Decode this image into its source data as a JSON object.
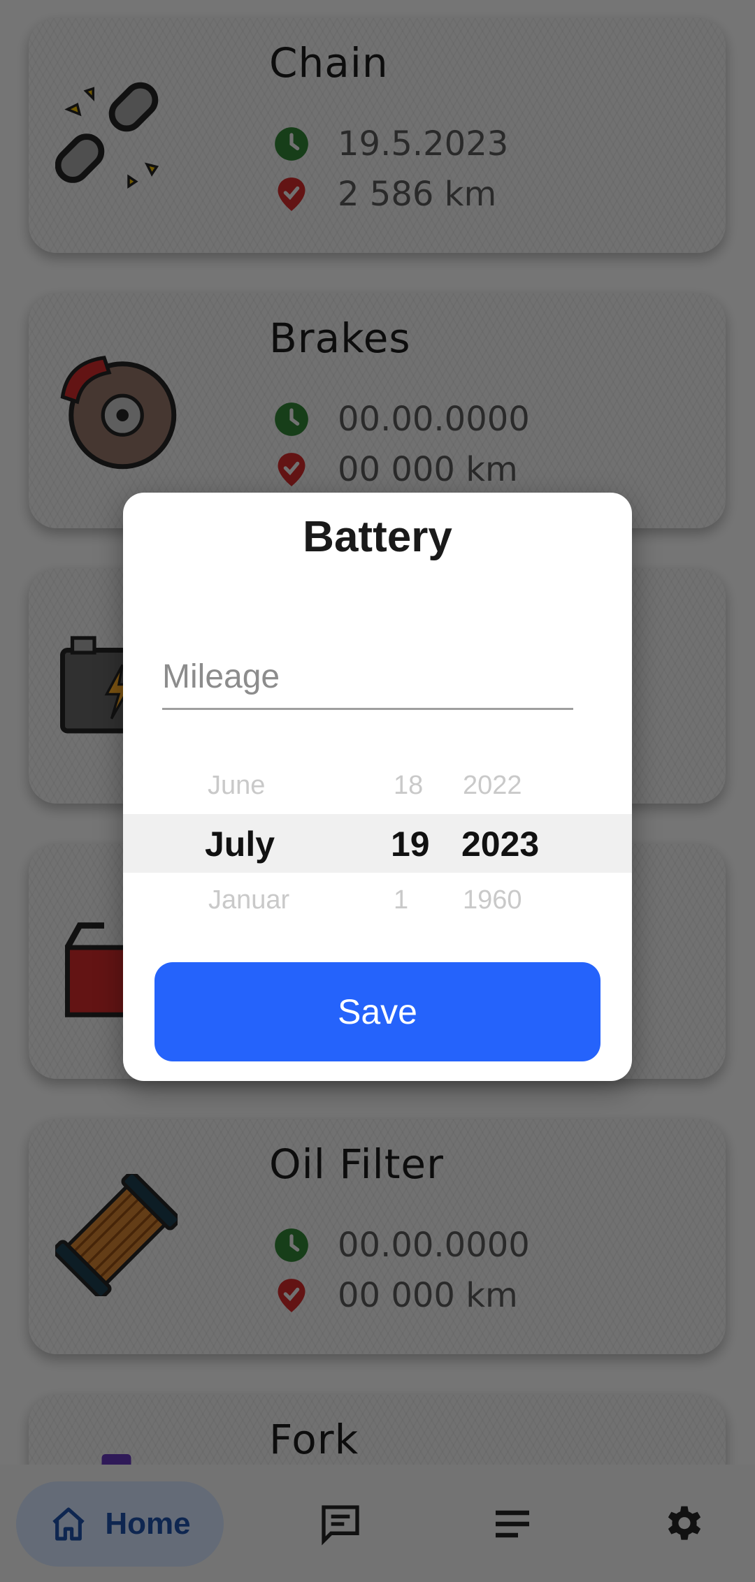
{
  "cards": [
    {
      "title": "Chain",
      "date": "19.5.2023",
      "mileage": "2 586 km",
      "icon": "chain-icon"
    },
    {
      "title": "Brakes",
      "date": "00.00.0000",
      "mileage": "00 000 km",
      "icon": "brake-disc-icon"
    },
    {
      "title": "",
      "date": "",
      "mileage": "",
      "icon": "battery-icon"
    },
    {
      "title": "",
      "date": "",
      "mileage": "",
      "icon": "oil-can-icon"
    },
    {
      "title": "Oil Filter",
      "date": "00.00.0000",
      "mileage": "00 000 km",
      "icon": "oil-filter-icon"
    },
    {
      "title": "Fork",
      "date": "",
      "mileage": "",
      "icon": "fork-icon"
    }
  ],
  "dialog": {
    "title": "Battery",
    "mileage_placeholder": "Mileage",
    "picker": {
      "month": {
        "prev": "June",
        "selected": "July",
        "next": "Januar"
      },
      "day": {
        "prev": "18",
        "selected": "19",
        "next": "1"
      },
      "year": {
        "prev": "2022",
        "selected": "2023",
        "next": "1960"
      }
    },
    "save_label": "Save"
  },
  "nav": {
    "home_label": "Home",
    "accent": "#1c4da1"
  },
  "colors": {
    "save_button": "#2563fb",
    "clock_green": "#2e7d32",
    "pin_red": "#c62828"
  }
}
